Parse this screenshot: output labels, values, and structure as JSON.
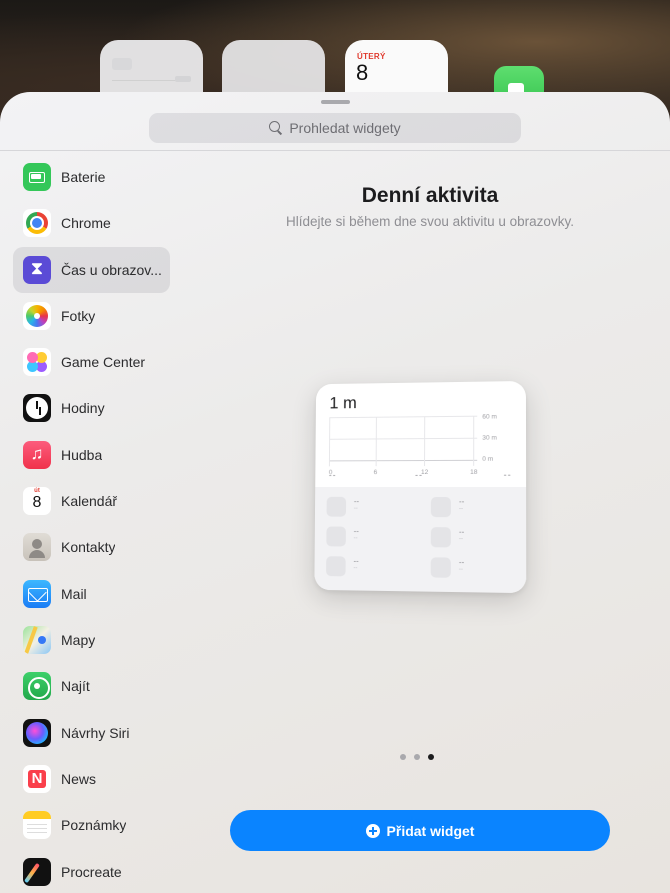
{
  "home_screen": {
    "calendar_widget": {
      "day": "ÚTERÝ",
      "date": "8"
    }
  },
  "search": {
    "placeholder": "Prohledat widgety",
    "icon": "search-icon"
  },
  "sidebar": {
    "items": [
      {
        "label": "Baterie",
        "icon": "battery-icon"
      },
      {
        "label": "Chrome",
        "icon": "chrome-icon"
      },
      {
        "label": "Čas u obrazov...",
        "icon": "screen-time-icon",
        "selected": true
      },
      {
        "label": "Fotky",
        "icon": "photos-icon"
      },
      {
        "label": "Game Center",
        "icon": "game-center-icon"
      },
      {
        "label": "Hodiny",
        "icon": "clock-icon"
      },
      {
        "label": "Hudba",
        "icon": "music-icon"
      },
      {
        "label": "Kalendář",
        "icon": "calendar-icon"
      },
      {
        "label": "Kontakty",
        "icon": "contacts-icon"
      },
      {
        "label": "Mail",
        "icon": "mail-icon"
      },
      {
        "label": "Mapy",
        "icon": "maps-icon"
      },
      {
        "label": "Najít",
        "icon": "find-my-icon"
      },
      {
        "label": "Návrhy Siri",
        "icon": "siri-icon"
      },
      {
        "label": "News",
        "icon": "news-icon"
      },
      {
        "label": "Poznámky",
        "icon": "notes-icon"
      },
      {
        "label": "Procreate",
        "icon": "procreate-icon"
      }
    ]
  },
  "main": {
    "title": "Denní aktivita",
    "subtitle": "Hlídejte si během dne svou aktivitu u obrazovky.",
    "widget_preview": {
      "total": "1 m",
      "y_labels": [
        "60 m",
        "30 m",
        "0 m"
      ],
      "x_labels": [
        "0",
        "6",
        "12",
        "18"
      ],
      "categories": [
        "--",
        "--",
        "--"
      ],
      "apps": [
        {
          "value": "--",
          "sub": "--"
        },
        {
          "value": "--",
          "sub": "--"
        },
        {
          "value": "--",
          "sub": "--"
        },
        {
          "value": "--",
          "sub": "--"
        },
        {
          "value": "--",
          "sub": "--"
        },
        {
          "value": "--",
          "sub": "--"
        }
      ]
    },
    "page_indicator": {
      "pages": 3,
      "current": 3
    },
    "add_button": {
      "label": "Přidat widget",
      "icon": "plus-circle-icon"
    }
  },
  "colors": {
    "accent": "#0a84ff",
    "selected_bg": "#e2e2e6"
  }
}
